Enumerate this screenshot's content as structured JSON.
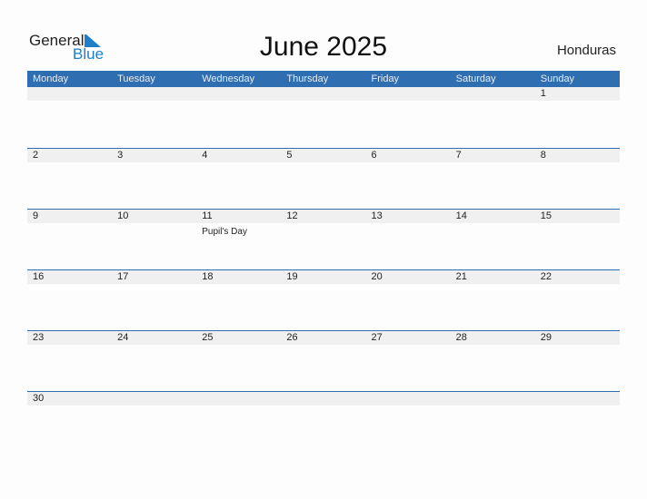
{
  "logo": {
    "line1": "General",
    "line2": "Blue"
  },
  "title": "June 2025",
  "country": "Honduras",
  "colors": {
    "header": "#2f6eb0",
    "brand": "#1e7fc8",
    "strip": "#f0f0f0"
  },
  "weekdays": [
    "Monday",
    "Tuesday",
    "Wednesday",
    "Thursday",
    "Friday",
    "Saturday",
    "Sunday"
  ],
  "weeks": [
    [
      {
        "d": ""
      },
      {
        "d": ""
      },
      {
        "d": ""
      },
      {
        "d": ""
      },
      {
        "d": ""
      },
      {
        "d": ""
      },
      {
        "d": "1"
      }
    ],
    [
      {
        "d": "2"
      },
      {
        "d": "3"
      },
      {
        "d": "4"
      },
      {
        "d": "5"
      },
      {
        "d": "6"
      },
      {
        "d": "7"
      },
      {
        "d": "8"
      }
    ],
    [
      {
        "d": "9"
      },
      {
        "d": "10"
      },
      {
        "d": "11",
        "event": "Pupil's Day"
      },
      {
        "d": "12"
      },
      {
        "d": "13"
      },
      {
        "d": "14"
      },
      {
        "d": "15"
      }
    ],
    [
      {
        "d": "16"
      },
      {
        "d": "17"
      },
      {
        "d": "18"
      },
      {
        "d": "19"
      },
      {
        "d": "20"
      },
      {
        "d": "21"
      },
      {
        "d": "22"
      }
    ],
    [
      {
        "d": "23"
      },
      {
        "d": "24"
      },
      {
        "d": "25"
      },
      {
        "d": "26"
      },
      {
        "d": "27"
      },
      {
        "d": "28"
      },
      {
        "d": "29"
      }
    ],
    [
      {
        "d": "30"
      },
      {
        "d": ""
      },
      {
        "d": ""
      },
      {
        "d": ""
      },
      {
        "d": ""
      },
      {
        "d": ""
      },
      {
        "d": ""
      }
    ]
  ]
}
